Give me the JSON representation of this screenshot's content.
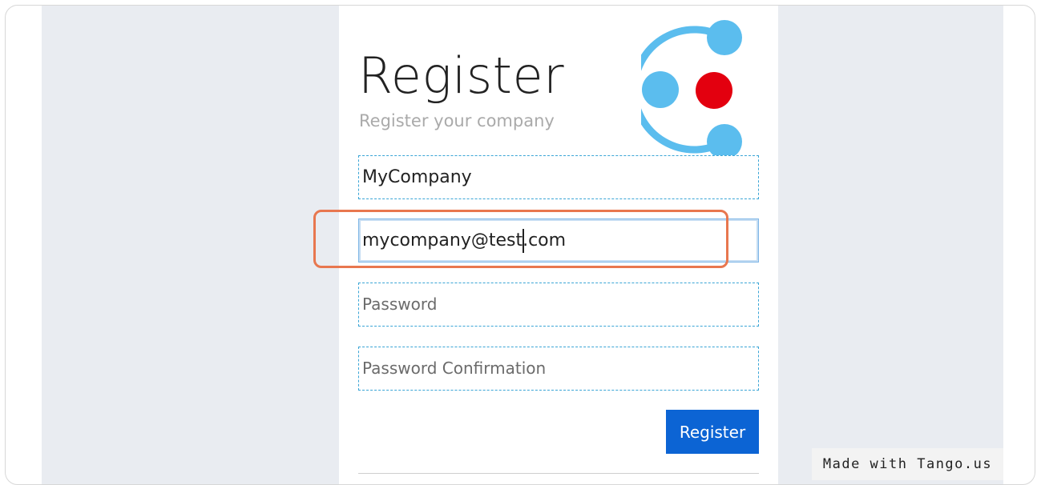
{
  "form": {
    "title": "Register",
    "subtitle": "Register your company",
    "company_value": "MyCompany",
    "email_value": "mycompany@test.com",
    "password_placeholder": "Password",
    "password_confirmation_placeholder": "Password Confirmation",
    "submit_label": "Register"
  },
  "logo": {
    "icon": "company-logo-icon",
    "ring_color": "#5bbdee",
    "center_color": "#e3000f"
  },
  "highlight": {
    "color": "#e8774f",
    "target": "email field"
  },
  "footer": {
    "badge_text": "Made with Tango.us"
  },
  "colors": {
    "page_background": "#e9ecf1",
    "card_background": "#ffffff",
    "button": "#0c64d4",
    "field_border": "#3aa5d6"
  }
}
